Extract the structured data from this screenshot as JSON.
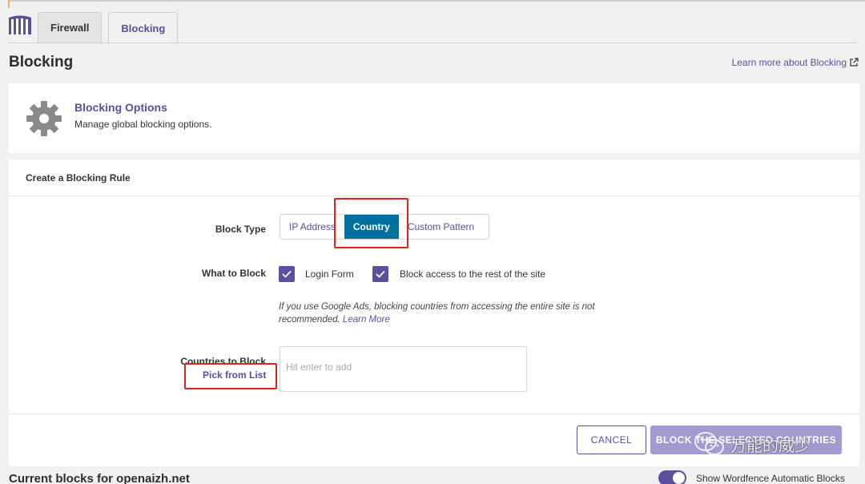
{
  "tabs": [
    {
      "label": "Firewall",
      "active": false
    },
    {
      "label": "Blocking",
      "active": true
    }
  ],
  "page": {
    "title": "Blocking",
    "learn_more": "Learn more about Blocking"
  },
  "options_card": {
    "title": "Blocking Options",
    "subtitle": "Manage global blocking options.",
    "icon": "gear-icon"
  },
  "rule": {
    "heading": "Create a Blocking Rule",
    "block_type_label": "Block Type",
    "block_types": [
      "IP Address",
      "Country",
      "Custom Pattern"
    ],
    "selected_block_type": "Country",
    "what_label": "What to Block",
    "what_options": [
      {
        "label": "Login Form",
        "checked": true
      },
      {
        "label": "Block access to the rest of the site",
        "checked": true
      }
    ],
    "note": "If you use Google Ads, blocking countries from accessing the entire site is not recommended.",
    "note_link": "Learn More",
    "countries_label": "Countries to Block",
    "pick_link": "Pick from List",
    "countries_placeholder": "Hit enter to add",
    "cancel": "CANCEL",
    "submit": "BLOCK THE SELECTED COUNTRIES"
  },
  "current": {
    "title": "Current blocks for openaizh.net",
    "toggle_label": "Show Wordfence Automatic Blocks",
    "toggle_on": true
  },
  "watermark": {
    "text": "万能的威少"
  },
  "colors": {
    "accent": "#5b4f9e",
    "selected": "#00709e",
    "highlight": "#e2231a"
  }
}
